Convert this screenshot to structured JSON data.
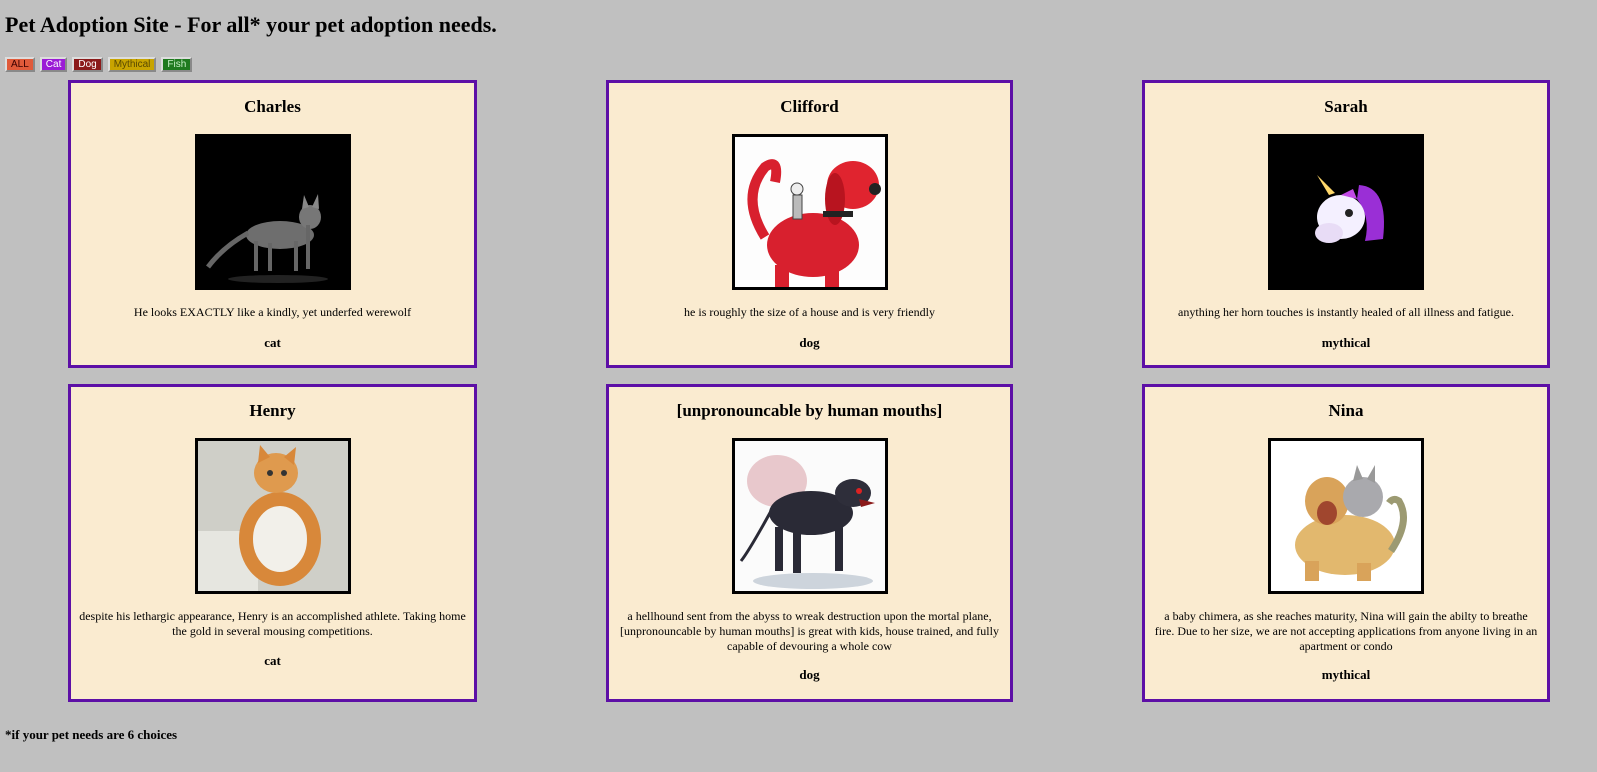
{
  "header": {
    "title": "Pet Adoption Site - For all* your pet adoption needs."
  },
  "filters": [
    {
      "label": "ALL",
      "bg": "#e05a3a",
      "fg": "#3a0000"
    },
    {
      "label": "Cat",
      "bg": "#9b1bd6",
      "fg": "#ffffff"
    },
    {
      "label": "Dog",
      "bg": "#8b1a1a",
      "fg": "#ffffff"
    },
    {
      "label": "Mythical",
      "bg": "#c8a400",
      "fg": "#5a4a00"
    },
    {
      "label": "Fish",
      "bg": "#1f7a1f",
      "fg": "#c8f0c8"
    }
  ],
  "pets": [
    {
      "name": "Charles",
      "description": "He looks EXACTLY like a kindly, yet underfed werewolf",
      "species": "cat",
      "image": "grey-cat-image"
    },
    {
      "name": "Clifford",
      "description": "he is roughly the size of a house and is very friendly",
      "species": "dog",
      "image": "big-red-dog-image"
    },
    {
      "name": "Sarah",
      "description": "anything her horn touches is instantly healed of all illness and fatigue.",
      "species": "mythical",
      "image": "unicorn-image"
    },
    {
      "name": "Henry",
      "description": "despite his lethargic appearance, Henry is an accomplished athlete. Taking home the gold in several mousing competitions.",
      "species": "cat",
      "image": "orange-cat-image"
    },
    {
      "name": "[unpronouncable by human mouths]",
      "description": "a hellhound sent from the abyss to wreak destruction upon the mortal plane, [unpronouncable by human mouths] is great with kids, house trained, and fully capable of devouring a whole cow",
      "species": "dog",
      "image": "hellhound-image"
    },
    {
      "name": "Nina",
      "description": "a baby chimera, as she reaches maturity, Nina will gain the abilty to breathe fire. Due to her size, we are not accepting applications from anyone living in an apartment or condo",
      "species": "mythical",
      "image": "chimera-image"
    }
  ],
  "footer": {
    "note": "*if your pet needs are 6 choices"
  }
}
